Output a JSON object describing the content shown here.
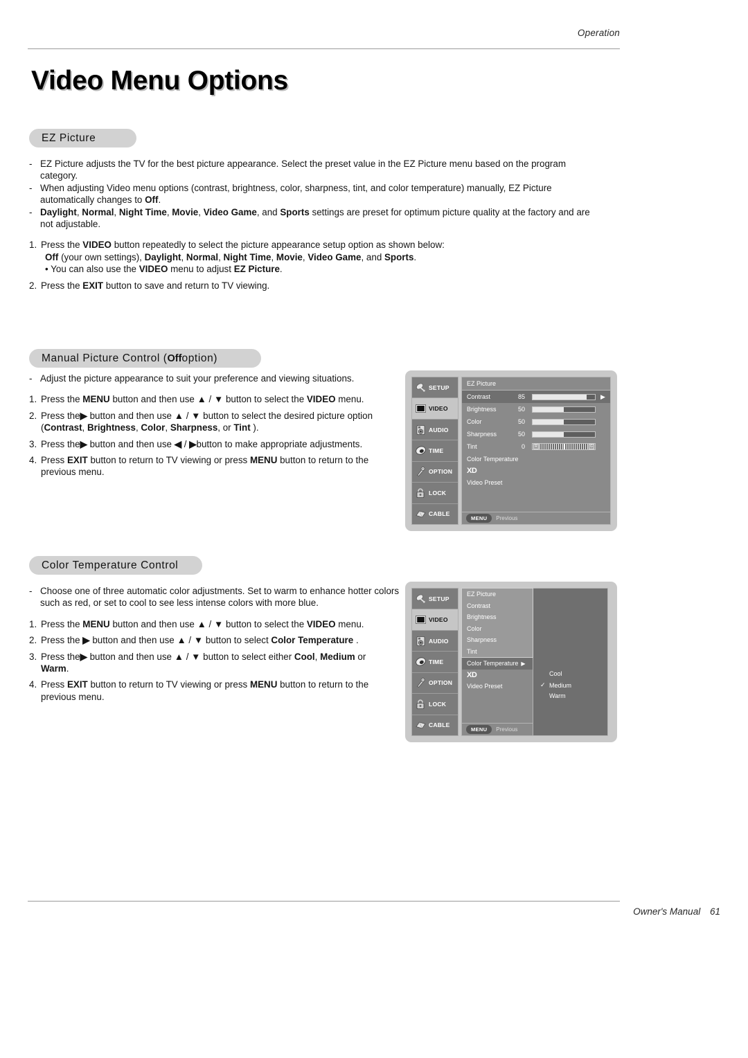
{
  "header": {
    "running_head": "Operation"
  },
  "title": "Video Menu Options",
  "footer": {
    "manual_label": "Owner's Manual",
    "page_number": "61"
  },
  "sections": {
    "ez_picture": {
      "pill_label": "EZ Picture",
      "bullets": [
        {
          "marker": "-",
          "parts": [
            {
              "t": "EZ Picture adjusts the TV for the best picture appearance. Select the preset value in the EZ Picture menu based on the program category.",
              "b": false
            }
          ]
        },
        {
          "marker": "-",
          "parts": [
            {
              "t": "When adjusting Video menu options (contrast, brightness, color, sharpness, tint, and color temperature) manually, EZ Picture automatically changes to ",
              "b": false
            },
            {
              "t": "Off",
              "b": true
            },
            {
              "t": ".",
              "b": false
            }
          ]
        },
        {
          "marker": "-",
          "parts": [
            {
              "t": "Daylight",
              "b": true
            },
            {
              "t": ", ",
              "b": false
            },
            {
              "t": "Normal",
              "b": true
            },
            {
              "t": ", ",
              "b": false
            },
            {
              "t": "Night Time",
              "b": true
            },
            {
              "t": ", ",
              "b": false
            },
            {
              "t": "Movie",
              "b": true
            },
            {
              "t": ", ",
              "b": false
            },
            {
              "t": "Video Game",
              "b": true
            },
            {
              "t": ", and ",
              "b": false
            },
            {
              "t": "Sports",
              "b": true
            },
            {
              "t": " settings are preset for optimum picture quality at the factory and are not adjustable.",
              "b": false
            }
          ]
        }
      ],
      "steps": [
        {
          "marker": "1.",
          "parts": [
            {
              "t": "Press the ",
              "b": false
            },
            {
              "t": "VIDEO",
              "b": true
            },
            {
              "t": " button repeatedly to select the picture appearance setup option as shown below:",
              "b": false
            }
          ],
          "sublines": [
            {
              "indent": true,
              "parts": [
                {
                  "t": "Off",
                  "b": true
                },
                {
                  "t": " (your own settings), ",
                  "b": false
                },
                {
                  "t": "Daylight",
                  "b": true
                },
                {
                  "t": ", ",
                  "b": false
                },
                {
                  "t": "Normal",
                  "b": true
                },
                {
                  "t": ", ",
                  "b": false
                },
                {
                  "t": "Night Time",
                  "b": true
                },
                {
                  "t": ", ",
                  "b": false
                },
                {
                  "t": "Movie",
                  "b": true
                },
                {
                  "t": ", ",
                  "b": false
                },
                {
                  "t": "Video Game",
                  "b": true
                },
                {
                  "t": ", and ",
                  "b": false
                },
                {
                  "t": "Sports",
                  "b": true
                },
                {
                  "t": ".",
                  "b": false
                }
              ]
            },
            {
              "indent": true,
              "parts": [
                {
                  "t": "• You can also use the ",
                  "b": false
                },
                {
                  "t": "VIDEO",
                  "b": true
                },
                {
                  "t": " menu to adjust ",
                  "b": false
                },
                {
                  "t": "EZ Picture",
                  "b": true
                },
                {
                  "t": ".",
                  "b": false
                }
              ]
            }
          ]
        },
        {
          "marker": "2.",
          "parts": [
            {
              "t": "Press the ",
              "b": false
            },
            {
              "t": "EXIT",
              "b": true
            },
            {
              "t": " button to save and return to TV viewing.",
              "b": false
            }
          ],
          "sublines": []
        }
      ]
    },
    "manual_picture": {
      "pill_prefix": "Manual Picture Control (",
      "pill_bold": "Off",
      "pill_suffix": " option)",
      "bullets": [
        {
          "marker": "-",
          "parts": [
            {
              "t": "Adjust the picture appearance to suit your preference and viewing situations.",
              "b": false
            }
          ]
        }
      ],
      "steps": [
        {
          "marker": "1.",
          "parts": [
            {
              "t": "Press the ",
              "b": false
            },
            {
              "t": "MENU",
              "b": true
            },
            {
              "t": " button and then use ",
              "b": false
            },
            {
              "t": "▲",
              "b": true
            },
            {
              "t": " / ",
              "b": false
            },
            {
              "t": "▼",
              "b": true
            },
            {
              "t": " button to select the ",
              "b": false
            },
            {
              "t": "VIDEO",
              "b": true
            },
            {
              "t": " menu.",
              "b": false
            }
          ],
          "sublines": []
        },
        {
          "marker": "2.",
          "parts": [
            {
              "t": "Press the",
              "b": false
            },
            {
              "t": "▶",
              "b": true
            },
            {
              "t": " button and then use ",
              "b": false
            },
            {
              "t": "▲",
              "b": true
            },
            {
              "t": " / ",
              "b": false
            },
            {
              "t": "▼",
              "b": true
            },
            {
              "t": " button to select the desired picture option",
              "b": false
            }
          ],
          "sublines": [
            {
              "indent": false,
              "parts": [
                {
                  "t": "(",
                  "b": false
                },
                {
                  "t": "Contrast",
                  "b": true
                },
                {
                  "t": ", ",
                  "b": false
                },
                {
                  "t": "Brightness",
                  "b": true
                },
                {
                  "t": ", ",
                  "b": false
                },
                {
                  "t": "Color",
                  "b": true
                },
                {
                  "t": ", ",
                  "b": false
                },
                {
                  "t": "Sharpness",
                  "b": true
                },
                {
                  "t": ", or ",
                  "b": false
                },
                {
                  "t": "Tint",
                  "b": true
                },
                {
                  "t": " ).",
                  "b": false
                }
              ]
            }
          ]
        },
        {
          "marker": "3.",
          "parts": [
            {
              "t": "Press the",
              "b": false
            },
            {
              "t": "▶",
              "b": true
            },
            {
              "t": " button and then use ",
              "b": false
            },
            {
              "t": "◀",
              "b": true
            },
            {
              "t": " / ",
              "b": false
            },
            {
              "t": "▶",
              "b": true
            },
            {
              "t": "button to make appropriate adjustments.",
              "b": false
            }
          ],
          "sublines": []
        },
        {
          "marker": "4.",
          "parts": [
            {
              "t": "Press ",
              "b": false
            },
            {
              "t": "EXIT",
              "b": true
            },
            {
              "t": " button to return to TV viewing or press ",
              "b": false
            },
            {
              "t": "MENU",
              "b": true
            },
            {
              "t": " button to return to the previous menu.",
              "b": false
            }
          ],
          "sublines": []
        }
      ]
    },
    "color_temperature": {
      "pill_label": "Color Temperature Control",
      "bullets": [
        {
          "marker": "-",
          "parts": [
            {
              "t": "Choose one of three automatic color adjustments. Set to warm to enhance hotter colors such as red, or set to cool to see less intense colors with more blue.",
              "b": false
            }
          ]
        }
      ],
      "steps": [
        {
          "marker": "1.",
          "parts": [
            {
              "t": "Press the ",
              "b": false
            },
            {
              "t": "MENU",
              "b": true
            },
            {
              "t": " button and then use ",
              "b": false
            },
            {
              "t": "▲",
              "b": true
            },
            {
              "t": " / ",
              "b": false
            },
            {
              "t": "▼",
              "b": true
            },
            {
              "t": " button to select the ",
              "b": false
            },
            {
              "t": "VIDEO",
              "b": true
            },
            {
              "t": " menu.",
              "b": false
            }
          ],
          "sublines": []
        },
        {
          "marker": "2.",
          "parts": [
            {
              "t": "Press the ",
              "b": false
            },
            {
              "t": "▶",
              "b": true
            },
            {
              "t": " button and then use ",
              "b": false
            },
            {
              "t": "▲",
              "b": true
            },
            {
              "t": " / ",
              "b": false
            },
            {
              "t": "▼",
              "b": true
            },
            {
              "t": " button to select ",
              "b": false
            },
            {
              "t": "Color Temperature",
              "b": true
            },
            {
              "t": " .",
              "b": false
            }
          ],
          "sublines": []
        },
        {
          "marker": "3.",
          "parts": [
            {
              "t": "Press the",
              "b": false
            },
            {
              "t": "▶",
              "b": true
            },
            {
              "t": " button and then use ",
              "b": false
            },
            {
              "t": "▲",
              "b": true
            },
            {
              "t": " / ",
              "b": false
            },
            {
              "t": "▼",
              "b": true
            },
            {
              "t": " button to select either ",
              "b": false
            },
            {
              "t": "Cool",
              "b": true
            },
            {
              "t": ", ",
              "b": false
            },
            {
              "t": "Medium",
              "b": true
            },
            {
              "t": " or",
              "b": false
            }
          ],
          "sublines": [
            {
              "indent": false,
              "parts": [
                {
                  "t": "Warm",
                  "b": true
                },
                {
                  "t": ".",
                  "b": false
                }
              ]
            }
          ]
        },
        {
          "marker": "4.",
          "parts": [
            {
              "t": "Press ",
              "b": false
            },
            {
              "t": "EXIT",
              "b": true
            },
            {
              "t": " button to return to TV viewing or press ",
              "b": false
            },
            {
              "t": "MENU",
              "b": true
            },
            {
              "t": " button to return to the previous menu.",
              "b": false
            }
          ],
          "sublines": []
        }
      ]
    }
  },
  "osd": {
    "sidebar": [
      {
        "label": "SETUP",
        "icon": "satellite-dish-icon",
        "active": false
      },
      {
        "label": "VIDEO",
        "icon": "tv-screen-icon",
        "active": true
      },
      {
        "label": "AUDIO",
        "icon": "speaker-icon",
        "active": false
      },
      {
        "label": "TIME",
        "icon": "clock-icon",
        "active": false
      },
      {
        "label": "OPTION",
        "icon": "wrench-icon",
        "active": false
      },
      {
        "label": "LOCK",
        "icon": "padlock-icon",
        "active": false
      },
      {
        "label": "CABLE",
        "icon": "cable-icon",
        "active": false
      }
    ],
    "footer_chip": "MENU",
    "footer_text": "Previous",
    "screen1": {
      "header": "EZ Picture",
      "rows": [
        {
          "label": "Contrast",
          "value": "85",
          "fill": 87,
          "selected": true,
          "arrow": "▶"
        },
        {
          "label": "Brightness",
          "value": "50",
          "fill": 50,
          "selected": false,
          "arrow": ""
        },
        {
          "label": "Color",
          "value": "50",
          "fill": 50,
          "selected": false,
          "arrow": ""
        },
        {
          "label": "Sharpness",
          "value": "50",
          "fill": 50,
          "selected": false,
          "arrow": ""
        }
      ],
      "tint": {
        "label": "Tint",
        "value": "0",
        "left_cap": "R",
        "right_cap": "G"
      },
      "plain_rows": [
        "Color Temperature"
      ],
      "xd_label": "XD",
      "video_preset": "Video Preset"
    },
    "screen2": {
      "items": [
        {
          "label": "EZ Picture",
          "selected": false,
          "arrow": ""
        },
        {
          "label": "Contrast",
          "selected": false,
          "arrow": ""
        },
        {
          "label": "Brightness",
          "selected": false,
          "arrow": ""
        },
        {
          "label": "Color",
          "selected": false,
          "arrow": ""
        },
        {
          "label": "Sharpness",
          "selected": false,
          "arrow": ""
        },
        {
          "label": "Tint",
          "selected": false,
          "arrow": ""
        },
        {
          "label": "Color Temperature",
          "selected": true,
          "arrow": "▶"
        }
      ],
      "xd_label": "XD",
      "video_preset": "Video Preset",
      "submenu": [
        {
          "label": "Cool",
          "checked": false
        },
        {
          "label": "Medium",
          "checked": true
        },
        {
          "label": "Warm",
          "checked": false
        }
      ],
      "check_glyph": "✓"
    }
  }
}
